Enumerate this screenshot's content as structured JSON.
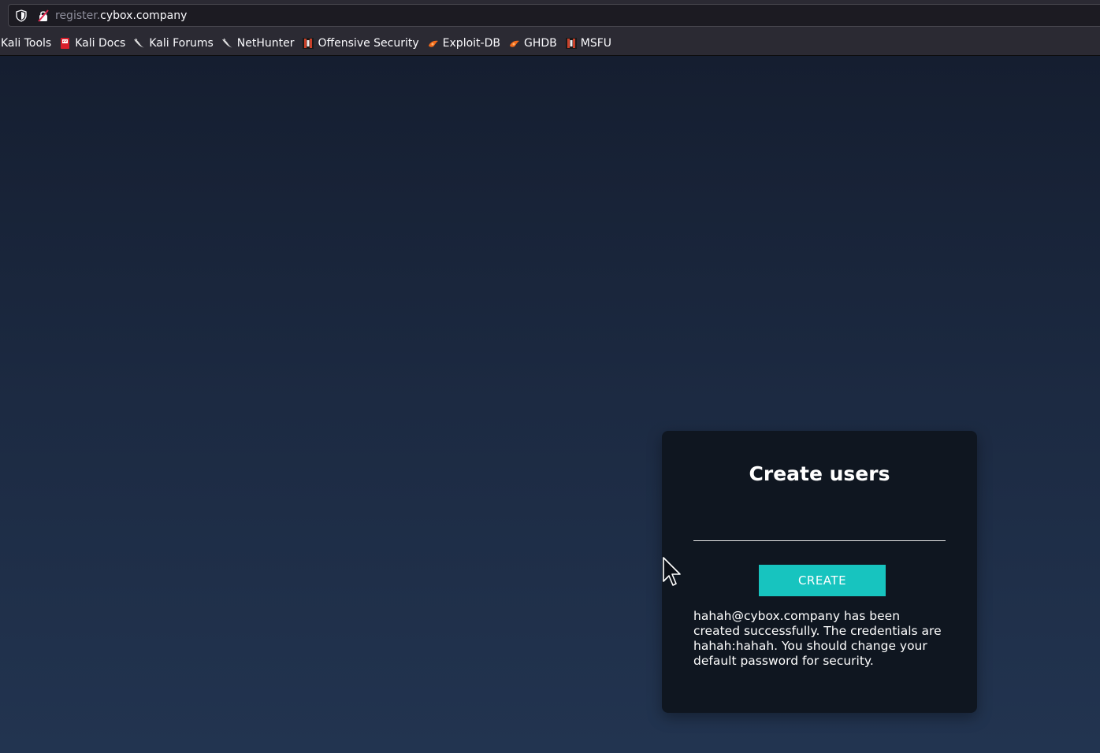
{
  "browser": {
    "url_subdomain": "register.",
    "url_domain": "cybox.company"
  },
  "bookmarks": [
    {
      "label": "Kali Tools",
      "icon": "none"
    },
    {
      "label": "Kali Docs",
      "icon": "kali-docs-icon"
    },
    {
      "label": "Kali Forums",
      "icon": "kali-dragon-icon"
    },
    {
      "label": "NetHunter",
      "icon": "kali-dragon-icon"
    },
    {
      "label": "Offensive Security",
      "icon": "offsec-icon"
    },
    {
      "label": "Exploit-DB",
      "icon": "exploitdb-icon"
    },
    {
      "label": "GHDB",
      "icon": "exploitdb-icon"
    },
    {
      "label": "MSFU",
      "icon": "offsec-icon"
    }
  ],
  "form": {
    "title": "Create users",
    "email_value": "",
    "button_label": "CREATE",
    "result_message": "hahah@cybox.company has been created successfully. The credentials are hahah:hahah. You should change your default password for security."
  },
  "colors": {
    "accent": "#17c4bf",
    "card_bg": "#0f1620",
    "page_bg_top": "#151e30",
    "page_bg_bottom": "#223450"
  }
}
